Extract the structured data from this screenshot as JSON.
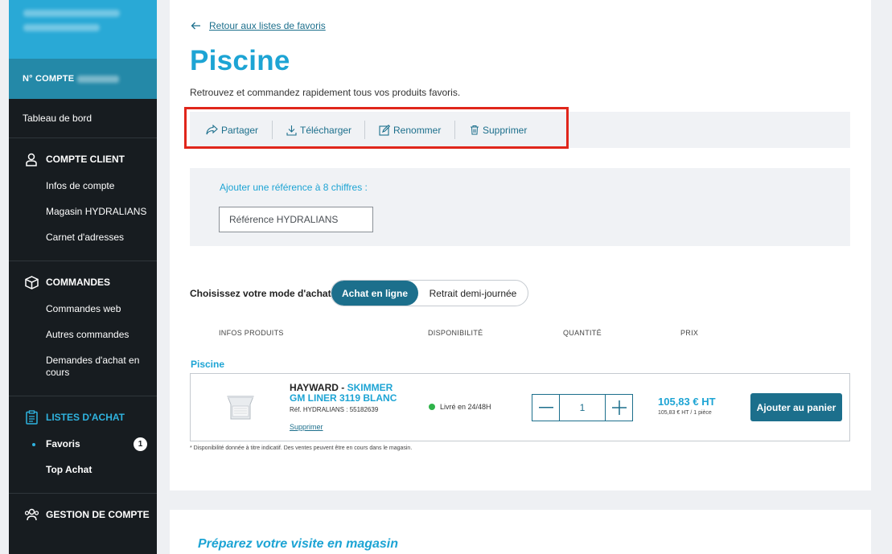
{
  "sidebar": {
    "account_label": "N° COMPTE",
    "dashboard": "Tableau de bord",
    "sections": {
      "client": {
        "title": "COMPTE CLIENT",
        "items": [
          "Infos de compte",
          "Magasin HYDRALIANS",
          "Carnet d'adresses"
        ]
      },
      "orders": {
        "title": "COMMANDES",
        "items": [
          "Commandes web",
          "Autres commandes",
          "Demandes d'achat en cours"
        ]
      },
      "lists": {
        "title": "LISTES D'ACHAT",
        "items": [
          "Favoris",
          "Top Achat"
        ],
        "favoris_badge": "1"
      },
      "manage": {
        "title": "GESTION DE COMPTE"
      }
    },
    "accent_color": "#2fb3df"
  },
  "main": {
    "back_link": "Retour aux listes de favoris",
    "title": "Piscine",
    "subtitle": "Retrouvez et commandez rapidement tous vos produits favoris.",
    "toolbar": {
      "share": "Partager",
      "download": "Télécharger",
      "rename": "Renommer",
      "delete": "Supprimer"
    },
    "reference": {
      "label": "Ajouter une référence à 8 chiffres :",
      "placeholder": "Référence HYDRALIANS"
    },
    "purchase_mode": {
      "label": "Choisissez votre mode d'achat :",
      "online": "Achat en ligne",
      "pickup": "Retrait demi-journée"
    },
    "columns": {
      "product": "INFOS PRODUITS",
      "availability": "DISPONIBILITÉ",
      "quantity": "QUANTITÉ",
      "price": "PRIX"
    },
    "group_title": "Piscine",
    "product": {
      "brand": "HAYWARD -",
      "name": "SKIMMER GM LINER 3119 BLANC",
      "ref": "Réf. HYDRALIANS : 55182639",
      "delete": "Supprimer",
      "availability": "Livré en 24/48H",
      "quantity": "1",
      "price": "105,83 € HT",
      "unit_price": "105,83 € HT / 1 pièce",
      "cart_button": "Ajouter au panier"
    },
    "footnote": "* Disponibilité donnée à titre indicatif. Des ventes peuvent être en cours dans le magasin.",
    "visit_title": "Préparez votre visite en magasin"
  }
}
